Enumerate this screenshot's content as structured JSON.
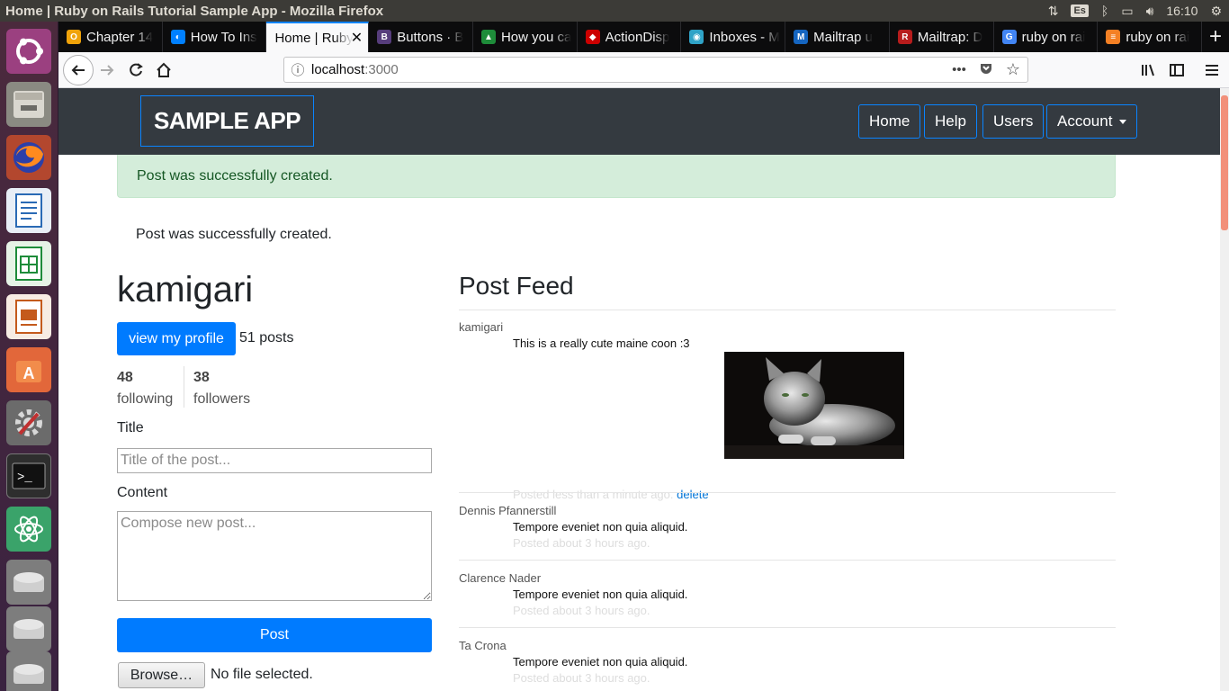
{
  "os": {
    "window_title": "Home | Ruby on Rails Tutorial Sample App - Mozilla Firefox",
    "keyboard_layout": "Es",
    "clock": "16:10"
  },
  "browser": {
    "tabs": [
      {
        "label": "Chapter 14",
        "icon": "circle-o-icon",
        "color": "#f0a30a"
      },
      {
        "label": "How To Ins",
        "icon": "digitalocean-icon",
        "color": "#0080ff"
      },
      {
        "label": "Home | Ruby",
        "icon": "none",
        "color": "#ffffff",
        "active": true
      },
      {
        "label": "Buttons · B",
        "icon": "bootstrap-icon",
        "color": "#563d7c"
      },
      {
        "label": "How you ca",
        "icon": "app-icon",
        "color": "#1e8c3a"
      },
      {
        "label": "ActionDisp",
        "icon": "ruby-icon",
        "color": "#cc0000"
      },
      {
        "label": "Inboxes - M",
        "icon": "mailtrap-icon",
        "color": "#2fa3c7"
      },
      {
        "label": "Mailtrap u",
        "icon": "m-icon",
        "color": "#1565c0"
      },
      {
        "label": "Mailtrap: D",
        "icon": "rt-icon",
        "color": "#b71c1c"
      },
      {
        "label": "ruby on rai",
        "icon": "google-icon",
        "color": "#4285f4"
      },
      {
        "label": "ruby on rai",
        "icon": "stackoverflow-icon",
        "color": "#f48024"
      }
    ],
    "url": {
      "host": "localhost",
      "port": ":3000"
    }
  },
  "site": {
    "brand": "SAMPLE APP",
    "nav": {
      "home": "Home",
      "help": "Help",
      "users": "Users",
      "account": "Account"
    },
    "flash": "Post was successfully created.",
    "notice": "Post was successfully created."
  },
  "profile": {
    "username": "kamigari",
    "view_profile": "view my profile",
    "post_count": "51 posts",
    "following_count": "48",
    "following_label": "following",
    "followers_count": "38",
    "followers_label": "followers"
  },
  "form": {
    "title_label": "Title",
    "title_placeholder": "Title of the post...",
    "content_label": "Content",
    "content_placeholder": "Compose new post...",
    "submit": "Post",
    "browse": "Browse…",
    "no_file": "No file selected."
  },
  "feed": {
    "title": "Post Feed",
    "delete_label": "delete",
    "posts": [
      {
        "author": "kamigari",
        "body": "This is a really cute maine coon :3",
        "time": "Posted less than a minute ago.",
        "image": "maine-coon-cat-photo"
      },
      {
        "author": "Dennis Pfannerstill",
        "body": "Tempore eveniet non quia aliquid.",
        "time": "Posted about 3 hours ago."
      },
      {
        "author": "Clarence Nader",
        "body": "Tempore eveniet non quia aliquid.",
        "time": "Posted about 3 hours ago."
      },
      {
        "author": "Ta Crona",
        "body": "Tempore eveniet non quia aliquid.",
        "time": "Posted about 3 hours ago."
      }
    ]
  },
  "colors": {
    "primary": "#007bff",
    "header_bg": "#343a40",
    "success_bg": "#d4edda",
    "success_text": "#155724"
  }
}
